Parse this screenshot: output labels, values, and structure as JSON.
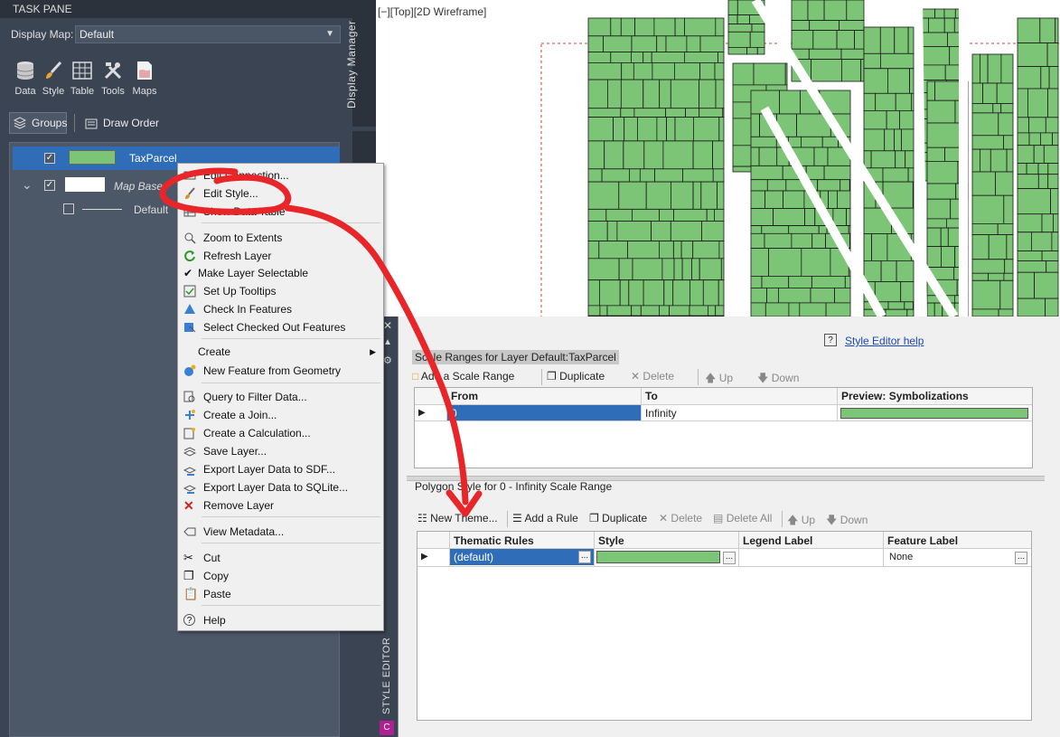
{
  "task_pane": {
    "title": "TASK PANE",
    "display_map_label": "Display Map:",
    "display_map_value": "Default",
    "tools": [
      {
        "label": "Data",
        "icon": "database-icon"
      },
      {
        "label": "Style",
        "icon": "brush-icon"
      },
      {
        "label": "Table",
        "icon": "table-icon"
      },
      {
        "label": "Tools",
        "icon": "tools-icon"
      },
      {
        "label": "Maps",
        "icon": "maps-icon"
      }
    ],
    "groups_label": "Groups",
    "draw_order_label": "Draw Order",
    "side_tab_label": "Display Manager",
    "layers": [
      {
        "name": "TaxParcel",
        "checked": true,
        "selected": true
      },
      {
        "name": "Map Base",
        "checked": true,
        "selected": false
      },
      {
        "name": "Default",
        "checked": false,
        "selected": false
      }
    ]
  },
  "map": {
    "viewport_label": "[−][Top][2D Wireframe]",
    "parcel_fill": "#7cc576",
    "parcel_stroke": "#1a1a1a"
  },
  "context_menu": {
    "items": [
      {
        "label": "Edit Connection...",
        "icon": "edit-connection-icon"
      },
      {
        "label": "Edit Style...",
        "icon": "brush-icon"
      },
      {
        "label": "Show Data Table",
        "icon": "table-icon"
      },
      {
        "label": "Zoom to Extents",
        "icon": "zoom-extents-icon"
      },
      {
        "label": "Refresh Layer",
        "icon": "refresh-icon"
      },
      {
        "label": "Make Layer Selectable",
        "icon": "check-icon"
      },
      {
        "label": "Set Up Tooltips",
        "icon": "tooltip-icon"
      },
      {
        "label": "Check In Features",
        "icon": "check-in-icon"
      },
      {
        "label": "Select Checked Out Features",
        "icon": "select-checked-out-icon"
      },
      {
        "label": "Create",
        "icon": ""
      },
      {
        "label": "New Feature from Geometry",
        "icon": "new-feature-icon"
      },
      {
        "label": "Query to Filter Data...",
        "icon": "query-icon"
      },
      {
        "label": "Create a Join...",
        "icon": "join-icon"
      },
      {
        "label": "Create a Calculation...",
        "icon": "calculation-icon"
      },
      {
        "label": "Save Layer...",
        "icon": "save-layer-icon"
      },
      {
        "label": "Export Layer Data to SDF...",
        "icon": "export-sdf-icon"
      },
      {
        "label": "Export Layer Data to SQLite...",
        "icon": "export-sqlite-icon"
      },
      {
        "label": "Remove Layer",
        "icon": "remove-icon"
      },
      {
        "label": "View Metadata...",
        "icon": "metadata-icon"
      },
      {
        "label": "Cut",
        "icon": "cut-icon"
      },
      {
        "label": "Copy",
        "icon": "copy-icon"
      },
      {
        "label": "Paste",
        "icon": "paste-icon"
      },
      {
        "label": "Help",
        "icon": "help-icon"
      }
    ]
  },
  "style_editor": {
    "side_label": "STYLE EDITOR",
    "help_link": "Style Editor help",
    "scale_ranges_title": "Scale Ranges for Layer Default:TaxParcel",
    "scale_toolbar": {
      "add": "Add a Scale Range",
      "duplicate": "Duplicate",
      "delete": "Delete",
      "up": "Up",
      "down": "Down"
    },
    "scale_columns": [
      "From",
      "To",
      "Preview: Symbolizations"
    ],
    "scale_rows": [
      {
        "from": "0",
        "to": "Infinity"
      }
    ],
    "polygon_title": "Polygon Style for 0 - Infinity Scale Range",
    "rules_toolbar": {
      "new_theme": "New Theme...",
      "add_rule": "Add a Rule",
      "duplicate": "Duplicate",
      "delete": "Delete",
      "delete_all": "Delete All",
      "up": "Up",
      "down": "Down"
    },
    "rules_columns": [
      "Thematic Rules",
      "Style",
      "Legend Label",
      "Feature Label"
    ],
    "rules_rows": [
      {
        "rule": "(default)",
        "legend_label": "",
        "feature_label": "None"
      }
    ],
    "ellipsis": "...",
    "style_fill": "#7cc576"
  },
  "annotation": {
    "color": "#e8262a"
  }
}
